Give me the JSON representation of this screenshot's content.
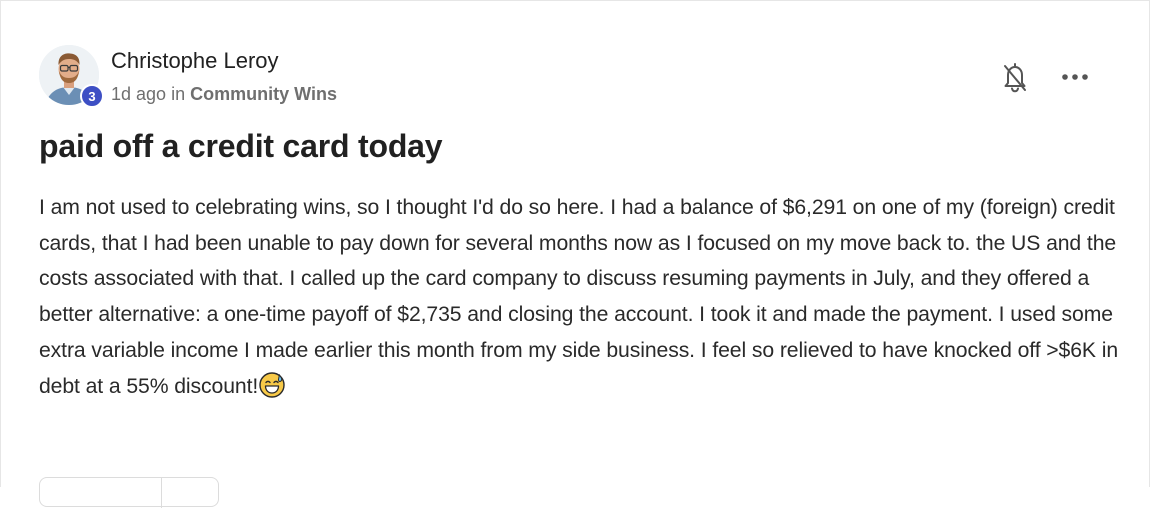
{
  "post": {
    "author": {
      "name": "Christophe Leroy",
      "level": "3"
    },
    "meta": {
      "time": "1d ago",
      "in_word": "in",
      "space": "Community Wins"
    },
    "title": "paid off a credit card today",
    "body": "I am not used to celebrating wins, so I thought I'd do so here. I had a balance of $6,291 on one of my (foreign) credit cards, that I had been unable to pay down for several months now as I focused on my move back to. the US and the costs associated with that. I called up the card company to discuss resuming payments in July, and they offered a better alternative: a one-time payoff of $2,735 and closing the account. I took it and made the payment. I used some extra variable income I made earlier this month from my side business. I feel so relieved to have knocked off >$6K in debt at a 55% discount!",
    "body_emoji": "grinning-sweat-emoji"
  },
  "actions": {
    "bell_icon": "bell-muted-icon",
    "more_icon": "more-horizontal-icon"
  },
  "colors": {
    "level_badge": "#3d4fc4",
    "text": "#212121",
    "meta": "#6f6f6f"
  }
}
